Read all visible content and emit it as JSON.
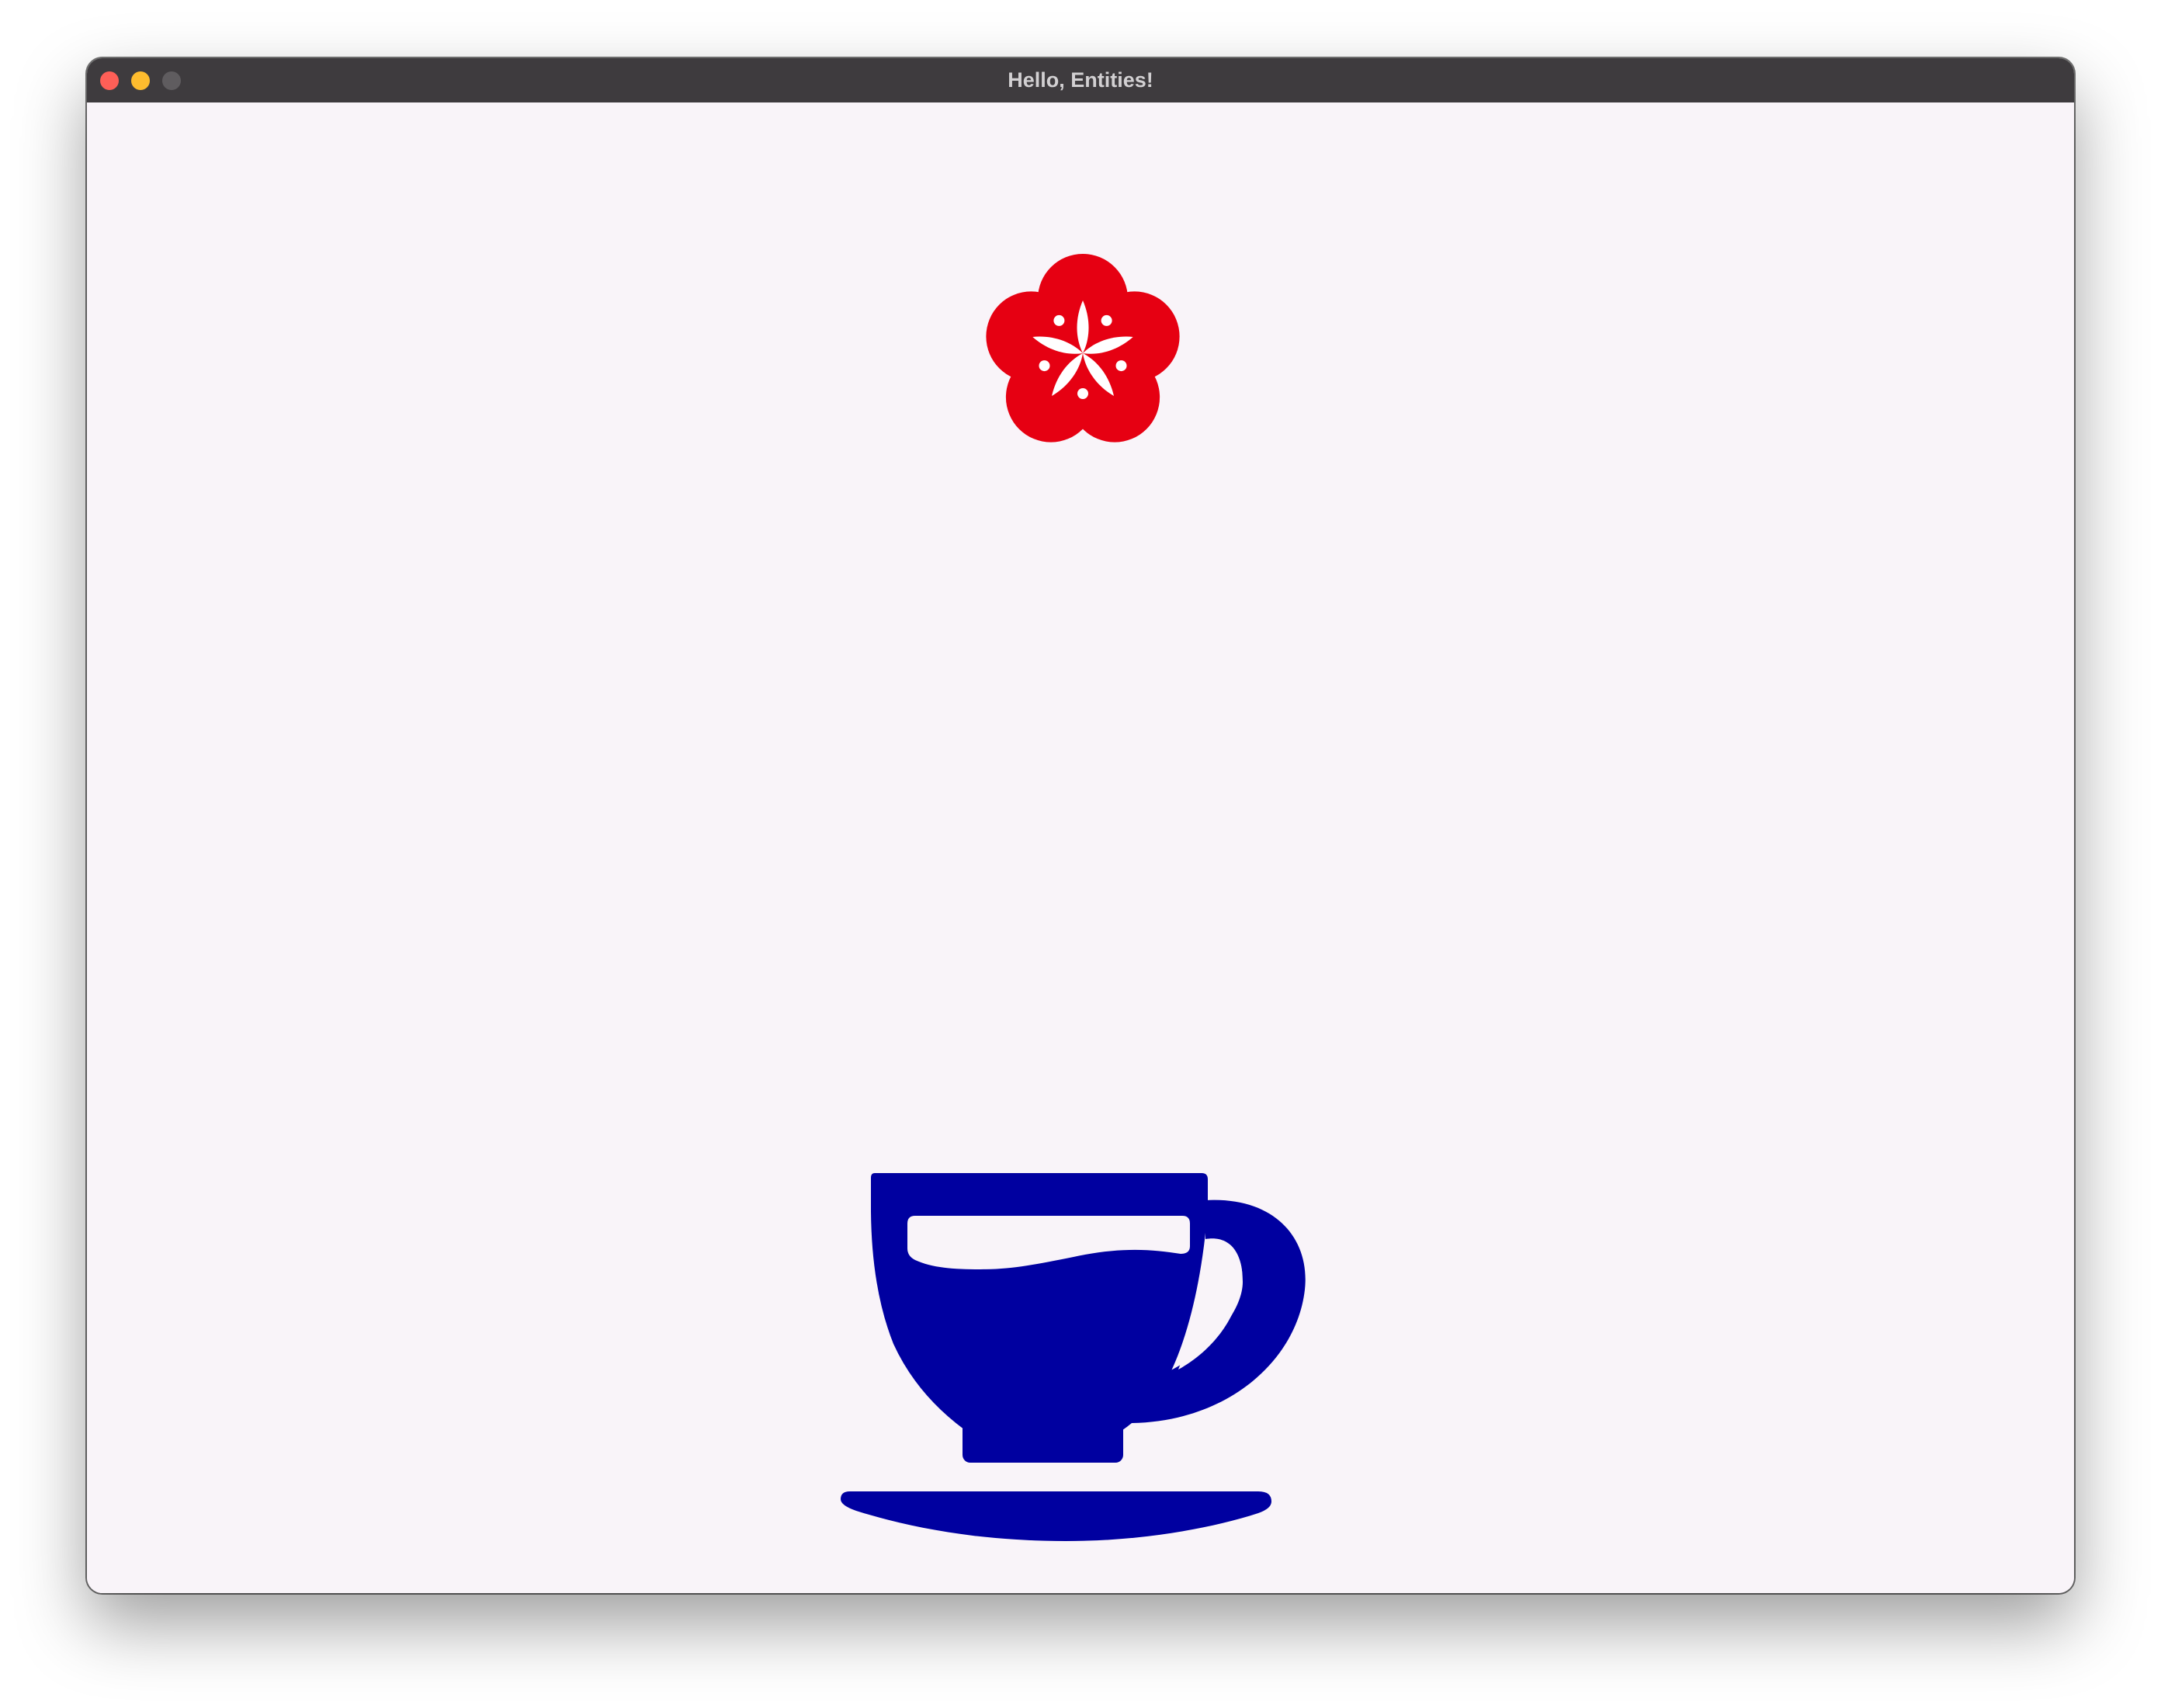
{
  "window": {
    "title": "Hello, Entities!",
    "controls": {
      "close": "close-button",
      "minimize": "minimize-button",
      "zoom": "zoom-button"
    }
  },
  "colors": {
    "titlebar": "#3e3b3e",
    "content_background": "#f9f4f9",
    "flower": "#e60012",
    "cup": "#0000a0",
    "close": "#fe5f57",
    "minimize": "#febc2e",
    "zoom": "#5f5c5f"
  },
  "entities": [
    {
      "name": "plum-blossom",
      "icon": "flower-icon",
      "color": "#e60012"
    },
    {
      "name": "teacup",
      "icon": "teacup-icon",
      "color": "#0000a0"
    }
  ]
}
